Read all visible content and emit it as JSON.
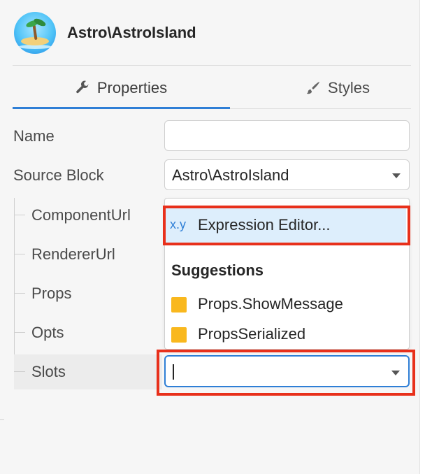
{
  "header": {
    "title": "Astro\\AstroIsland",
    "logo_icon": "tropical-island-icon"
  },
  "tabs": [
    {
      "label": "Properties",
      "icon": "wrench-icon",
      "active": true
    },
    {
      "label": "Styles",
      "icon": "paintbrush-icon",
      "active": false
    }
  ],
  "form": {
    "name_label": "Name",
    "name_value": "",
    "source_block_label": "Source Block",
    "source_block_value": "Astro\\AstroIsland"
  },
  "tree": {
    "items": [
      {
        "label": "ComponentUrl"
      },
      {
        "label": "RendererUrl"
      },
      {
        "label": "Props"
      },
      {
        "label": "Opts"
      },
      {
        "label": "Slots"
      }
    ]
  },
  "dropdown": {
    "expression_prefix": "x.y",
    "expression_label": "Expression Editor...",
    "suggestions_heading": "Suggestions",
    "suggestions": [
      {
        "label": "Props.ShowMessage",
        "color": "#f9b81e"
      },
      {
        "label": "PropsSerialized",
        "color": "#f9b81e"
      }
    ]
  },
  "slots_input": {
    "value": ""
  },
  "colors": {
    "accent": "#2f7fd6",
    "highlight": "#e8301b",
    "suggestion_swatch": "#f9b81e"
  }
}
